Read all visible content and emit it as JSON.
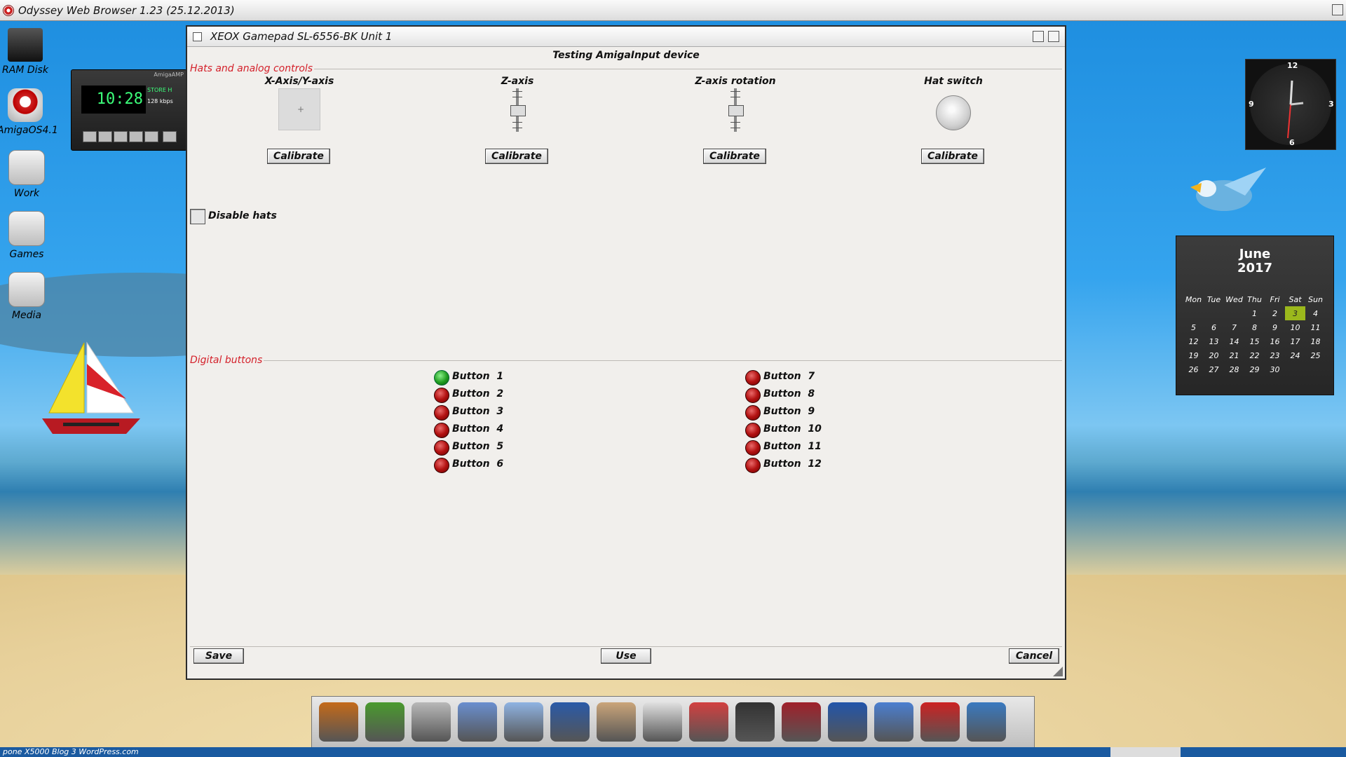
{
  "menubar": {
    "title": "Odyssey Web Browser 1.23 (25.12.2013)"
  },
  "desktop": {
    "icons": [
      {
        "label": "RAM Disk"
      },
      {
        "label": "AmigaOS4.1"
      },
      {
        "label": "Work"
      },
      {
        "label": "Games"
      },
      {
        "label": "Media"
      }
    ]
  },
  "amigaamp": {
    "title": "AmigaAMP",
    "time": "10:28",
    "info": "STORE H",
    "bitrate": "128 kbps"
  },
  "window": {
    "title": "XEOX Gamepad SL-6556-BK Unit 1",
    "subtitle": "Testing AmigaInput device",
    "hats_group": {
      "title": "Hats and analog controls",
      "controls": [
        {
          "label": "X-Axis/Y-axis",
          "calibrate": "Calibrate"
        },
        {
          "label": "Z-axis",
          "calibrate": "Calibrate"
        },
        {
          "label": "Z-axis rotation",
          "calibrate": "Calibrate"
        },
        {
          "label": "Hat switch",
          "calibrate": "Calibrate"
        }
      ],
      "xy_marker": "+",
      "disable_hats": {
        "label": "Disable hats",
        "checked": false
      }
    },
    "digital_group": {
      "title": "Digital buttons",
      "buttons": [
        {
          "label": "Button  1",
          "pressed": true
        },
        {
          "label": "Button  2",
          "pressed": false
        },
        {
          "label": "Button  3",
          "pressed": false
        },
        {
          "label": "Button  4",
          "pressed": false
        },
        {
          "label": "Button  5",
          "pressed": false
        },
        {
          "label": "Button  6",
          "pressed": false
        },
        {
          "label": "Button  7",
          "pressed": false
        },
        {
          "label": "Button  8",
          "pressed": false
        },
        {
          "label": "Button  9",
          "pressed": false
        },
        {
          "label": "Button  10",
          "pressed": false
        },
        {
          "label": "Button  11",
          "pressed": false
        },
        {
          "label": "Button  12",
          "pressed": false
        }
      ]
    },
    "footer": {
      "save": "Save",
      "use": "Use",
      "cancel": "Cancel"
    }
  },
  "clock": {
    "n12": "12",
    "n3": "3",
    "n6": "6",
    "n9": "9"
  },
  "calendar": {
    "month": "June",
    "year": "2017",
    "weekdays": [
      "Mon",
      "Tue",
      "Wed",
      "Thu",
      "Fri",
      "Sat",
      "Sun"
    ],
    "weeks": [
      [
        "",
        "",
        "",
        "1",
        "2",
        "3",
        "4"
      ],
      [
        "5",
        "6",
        "7",
        "8",
        "9",
        "10",
        "11"
      ],
      [
        "12",
        "13",
        "14",
        "15",
        "16",
        "17",
        "18"
      ],
      [
        "19",
        "20",
        "21",
        "22",
        "23",
        "24",
        "25"
      ],
      [
        "26",
        "27",
        "28",
        "29",
        "30",
        "",
        ""
      ]
    ],
    "today": "3"
  },
  "taskbar": {
    "text": "pone X5000 Blog 3 WordPress.com"
  }
}
